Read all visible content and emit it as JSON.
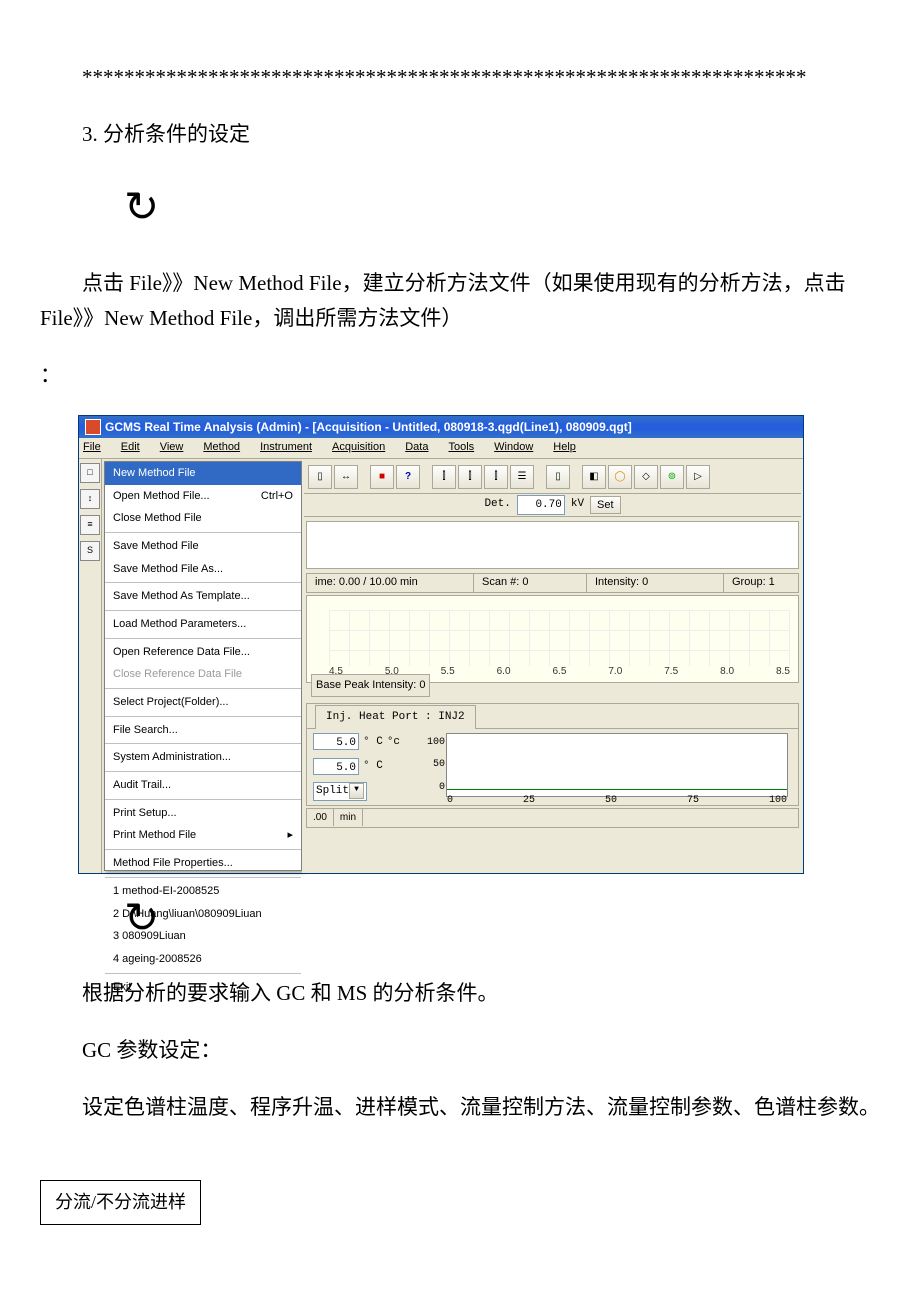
{
  "doc": {
    "asterisks": "*********************************************************************",
    "section": "3. 分析条件的设定",
    "clock1": "↻",
    "para1": "点击 File》》New Method File，建立分析方法文件（如果使用现有的分析方法，点击 File》》New Method File，调出所需方法文件）",
    "colon": "：",
    "clock2": "↻",
    "para2": "根据分析的要求输入 GC 和 MS 的分析条件。",
    "para3": "GC 参数设定：",
    "para4": "设定色谱柱温度、程序升温、进样模式、流量控制方法、流量控制参数、色谱柱参数。",
    "boxed": "分流/不分流进样"
  },
  "app": {
    "title": "GCMS Real Time Analysis (Admin) - [Acquisition - Untitled, 080918-3.qgd(Line1), 080909.qgt]",
    "menu": {
      "file": "File",
      "edit": "Edit",
      "view": "View",
      "method": "Method",
      "instrument": "Instrument",
      "acquisition": "Acquisition",
      "data": "Data",
      "tools": "Tools",
      "window": "Window",
      "help": "Help"
    },
    "file_menu": {
      "new_method": "New Method File",
      "open_method": "Open Method File...",
      "open_method_sc": "Ctrl+O",
      "close_method": "Close Method File",
      "save_method": "Save Method File",
      "save_method_as": "Save Method File As...",
      "save_template": "Save Method As Template...",
      "load_params": "Load Method Parameters...",
      "open_ref": "Open Reference Data File...",
      "close_ref": "Close Reference Data File",
      "select_project": "Select Project(Folder)...",
      "file_search": "File Search...",
      "sys_admin": "System Administration...",
      "audit": "Audit Trail...",
      "print_setup": "Print Setup...",
      "print_method": "Print Method File",
      "method_props": "Method File Properties...",
      "recent1": "1 method-EI-2008525",
      "recent2": "2 D:\\Huang\\liuan\\080909Liuan",
      "recent3": "3 080909Liuan",
      "recent4": "4 ageing-2008526",
      "exit": "Exit"
    },
    "det": {
      "label": "Det.",
      "value": "0.70",
      "unit": "kV",
      "set": "Set"
    },
    "status": {
      "time": "ime: 0.00 / 10.00 min",
      "scan": "Scan #: 0",
      "intensity": "Intensity: 0",
      "group": "Group: 1"
    },
    "plot": {
      "ticks": [
        "4.5",
        "5.0",
        "5.5",
        "6.0",
        "6.5",
        "7.0",
        "7.5",
        "8.0",
        "8.5"
      ],
      "bpi": "Base Peak Intensity: 0"
    },
    "panel": {
      "tab": "Inj. Heat Port : INJ2",
      "r1_val": "5.0",
      "r1_unit": "° C",
      "r1_extra": "°c",
      "r2_val": "5.0",
      "r2_unit": "° C",
      "combo_label": "Split",
      "sc_y": [
        "100",
        "50",
        "0"
      ],
      "sc_x": [
        "0",
        "25",
        "50",
        "75",
        "100"
      ]
    },
    "bottom": {
      "c1": ".00",
      "c2": "min"
    }
  }
}
